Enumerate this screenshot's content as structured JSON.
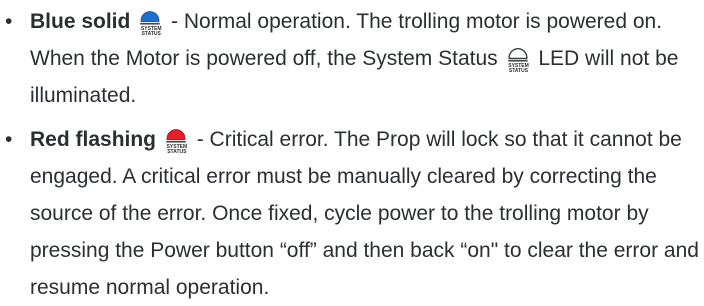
{
  "bullets": [
    {
      "term": "Blue solid",
      "led_color": "#1f6fd1",
      "led_outline": "#1a5fb8",
      "led_icon": "system-status-led-blue-icon",
      "text_before": " - Normal operation. The trolling motor is powered on. When the Motor is powered off, the System Status ",
      "inline_led_color": "#ffffff",
      "inline_led_outline": "#3a3f44",
      "inline_led_icon": "system-status-led-off-icon",
      "text_after": " LED will not be illuminated."
    },
    {
      "term": "Red flashing",
      "led_color": "#e4202a",
      "led_outline": "#c31a22",
      "led_icon": "system-status-led-red-icon",
      "text": " - Critical error. The Prop will lock so that it cannot be engaged. A critical error must be manually cleared by correcting the source of the error. Once fixed, cycle power to the trolling motor by pressing the Power button “off” and then back “on\" to clear the error and resume normal operation."
    }
  ],
  "led_caption": {
    "line1": "SYSTEM",
    "line2": "STATUS"
  },
  "bullet_glyph": "•",
  "text_color": "#2b2f33"
}
